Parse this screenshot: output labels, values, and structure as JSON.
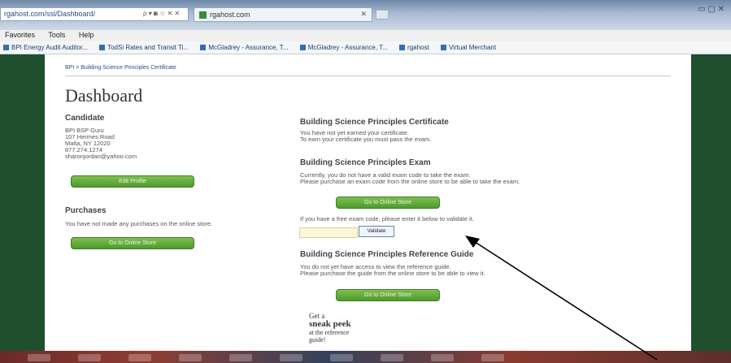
{
  "browser": {
    "address": "rgahost.com/ssl/Dashboard/",
    "address_icons": "ρ ▾ ◙ ☆ ✕ ✕",
    "tab_title": "rgahost.com",
    "window_buttons": "▭ ▢ ✕",
    "menu": [
      "Favorites",
      "Tools",
      "Help"
    ],
    "favorites": [
      "BPI Energy Audit Auditor...",
      "TodSi Rates and Transit Ti...",
      "McGladrey - Assurance, T...",
      "McGladrey - Assurance, T...",
      "rgahost",
      "Virtual Merchant"
    ]
  },
  "page": {
    "breadcrumb": "BPI > Building Science Principles Certificate",
    "title": "Dashboard",
    "candidate": {
      "heading": "Candidate",
      "lines": [
        "BPI BSP Guru",
        "107 Hermes Road",
        "Malta, NY 12020",
        "877.274.1274",
        "sharonjordan@yahoo.com"
      ],
      "edit_button": "Edit Profile"
    },
    "purchases": {
      "heading": "Purchases",
      "text": "You have not made any purchases on the online store.",
      "button": "Go to Online Store"
    },
    "certificate": {
      "heading": "Building Science Principles Certificate",
      "lines": [
        "You have not yet earned your certificate.",
        "To earn your certificate you must pass the exam."
      ]
    },
    "exam": {
      "heading": "Building Science Principles Exam",
      "lines": [
        "Currently, you do not have a valid exam code to take the exam.",
        "Please purchase an exam code from the online store to be able to take the exam."
      ],
      "button": "Go to Online Store",
      "code_prompt": "If you have a free exam code, please enter it below to validate it.",
      "code_value": "",
      "validate_button": "Validate"
    },
    "guide": {
      "heading": "Building Science Principles Reference Guide",
      "lines": [
        "You do not yet have access to view the reference guide.",
        "Please purchase the guide from the online store to be able to view it."
      ],
      "button": "Go to Online Store"
    },
    "sneak_peek": {
      "line1": "Get a",
      "line2": "sneak peek",
      "line3": "at the reference",
      "line4": "guide!"
    }
  },
  "colors": {
    "page_background": "#1f4f2e",
    "button_green": "#5aa536",
    "arrow": "#000000"
  }
}
